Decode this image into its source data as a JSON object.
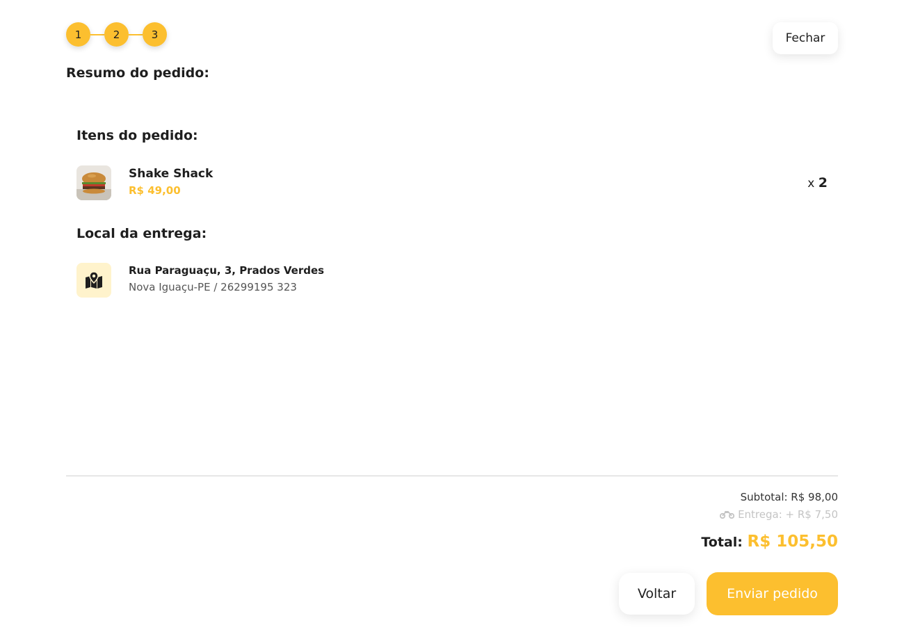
{
  "stepper": {
    "steps": [
      "1",
      "2",
      "3"
    ],
    "current_step": 3
  },
  "header": {
    "close_label": "Fechar",
    "title": "Resumo do pedido:"
  },
  "items_section": {
    "title": "Itens do pedido:",
    "items": [
      {
        "name": "Shake Shack",
        "price": "R$ 49,00",
        "qty_prefix": "x",
        "quantity": "2",
        "image": "burger-photo"
      }
    ]
  },
  "delivery_section": {
    "title": "Local da entrega:",
    "icon": "map-pin-icon",
    "address_line1": "Rua Paraguaçu, 3, Prados Verdes",
    "address_line2": "Nova Iguaçu-PE / 26299195 323"
  },
  "summary": {
    "subtotal": "Subtotal: R$ 98,00",
    "delivery_icon": "motorcycle-icon",
    "delivery_fee": "Entrega: + R$ 7,50",
    "total_label": "Total:",
    "total_value": "R$ 105,50"
  },
  "actions": {
    "back_label": "Voltar",
    "send_label": "Enviar pedido"
  },
  "colors": {
    "accent": "#fcbf2f",
    "text": "#1e1e1e",
    "muted": "#c4c4c4",
    "map_bg": "#fff3cc"
  }
}
